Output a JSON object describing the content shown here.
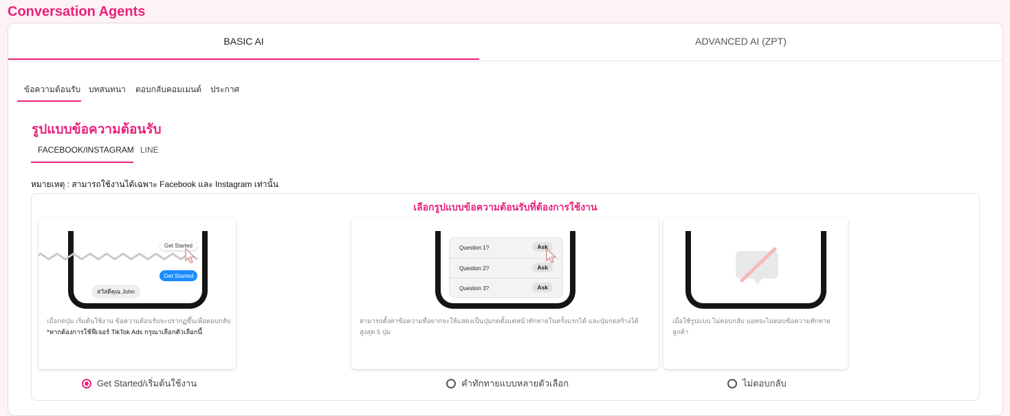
{
  "page": {
    "title": "Conversation Agents"
  },
  "main_tabs": [
    {
      "label": "BASIC AI",
      "active": true
    },
    {
      "label": "ADVANCED AI (ZPT)",
      "active": false
    }
  ],
  "sub_tabs": [
    {
      "label": "ข้อความต้อนรับ",
      "active": true
    },
    {
      "label": "บทสนทนา",
      "active": false
    },
    {
      "label": "ตอบกลับคอมเมนต์",
      "active": false
    },
    {
      "label": "ประกาศ",
      "active": false
    }
  ],
  "section": {
    "title": "รูปแบบข้อความต้อนรับ"
  },
  "platform_tabs": [
    {
      "label": "FACEBOOK/INSTAGRAM",
      "active": true
    },
    {
      "label": "LINE",
      "active": false
    }
  ],
  "note": "หมายเหตุ : สามารถใช้งานได้เฉพาะ Facebook และ Instagram เท่านั้น",
  "selection": {
    "title": "เลือกรูปแบบข้อความต้อนรับที่ต้องการใช้งาน",
    "options": [
      {
        "radio_label": "Get Started/เริ่มต้นใช้งาน",
        "selected": true,
        "description": "เมื่อกดปุ่ม เริ่มต้นใช้งาน ข้อความต้อนรับจะปรากฏขึ้นเพื่อตอบกลับ",
        "description_note": "*หากต้องการใช้ฟีเจอร์ TikTok Ads กรุณาเลือกตัวเลือกนี้",
        "preview": {
          "button_top": "Get Started",
          "button_blue": "Get Started",
          "greeting": "สวัสดีคุณ John"
        }
      },
      {
        "radio_label": "คำทักทายแบบหลายตัวเลือก",
        "selected": false,
        "description": "สามารถตั้งค่าข้อความที่อยากจะให้แสดงเป็นปุ่มกดตั้งแต่หน้าทักทายในครั้งแรกได้ และปุ่มกดสร้างได้สูงสุด 5 ปุ่ม",
        "preview": {
          "questions": [
            {
              "q": "Question 1?",
              "ask": "Ask"
            },
            {
              "q": "Question 2?",
              "ask": "Ask"
            },
            {
              "q": "Question 3?",
              "ask": "Ask"
            }
          ]
        }
      },
      {
        "radio_label": "ไม่ตอบกลับ",
        "selected": false,
        "description": "เมื่อใช้รูปแบบ ไม่ตอบกลับ บอทจะไม่ตอบข้อความทักทายลูกค้า"
      }
    ]
  },
  "colors": {
    "accent": "#e8217a",
    "background": "#fdf2f6",
    "messenger_blue": "#1a8cff"
  },
  "icons": [
    "cursor-pointer-icon",
    "no-message-icon",
    "radio-icon"
  ]
}
